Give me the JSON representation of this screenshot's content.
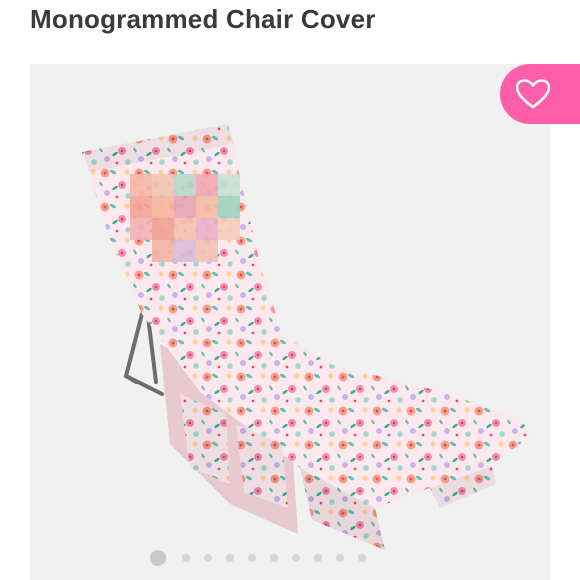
{
  "listing": {
    "title": "Monogrammed Chair Cover"
  },
  "gallery": {
    "image_alt": "Floral lounge chair towel cover",
    "slide_count": 10,
    "active_index": 0,
    "pattern_colors": [
      "#f7a08a",
      "#f48fb1",
      "#9fd8c9",
      "#c7b6ea",
      "#ffd29a",
      "#ffffff"
    ]
  },
  "like_button": {
    "icon": "heart-icon",
    "color": "#ff5fa8"
  }
}
